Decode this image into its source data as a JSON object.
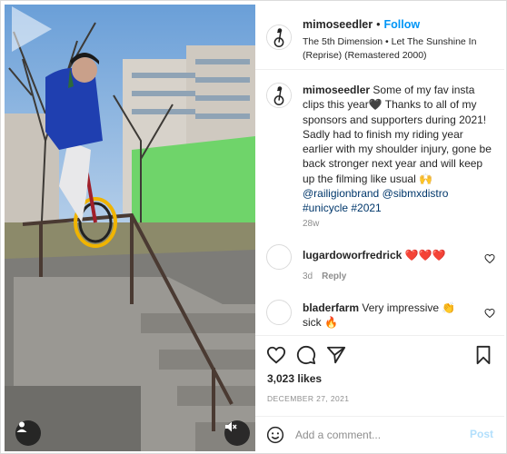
{
  "post": {
    "username": "mimoseedler",
    "follow_label": "Follow",
    "dot": "•",
    "music": "The 5th Dimension • Let The Sunshine In (Reprise) (Remastered 2000)",
    "caption": {
      "text": "Some of my fav insta clips this year🖤 Thanks to all of my sponsors and supporters during 2021! Sadly had to finish my riding year earlier with my shoulder injury, gone be back stronger next year and will keep up the filming like usual 🙌",
      "mentions": "@railigionbrand @sibmxdistro",
      "hashtags": "#unicycle #2021",
      "time_ago": "28w"
    },
    "comments": [
      {
        "username": "lugardoworfredrick",
        "text": "❤️❤️❤️",
        "time_ago": "3d",
        "reply_label": "Reply"
      },
      {
        "username": "bladerfarm",
        "text": "Very impressive 👏 sick 🔥"
      }
    ],
    "likes": "3,023 likes",
    "date": "DECEMBER 27, 2021",
    "comment_placeholder": "Add a comment...",
    "post_label": "Post"
  },
  "icons": {
    "like": "heart-icon",
    "comment": "comment-icon",
    "share": "paper-plane-icon",
    "save": "bookmark-icon",
    "emoji": "smiley-icon",
    "play": "play-icon",
    "user_tag": "user-icon",
    "mute": "speaker-muted-icon"
  },
  "colors": {
    "accent": "#0095f6",
    "text": "#262626",
    "muted": "#8e8e8e",
    "link": "#00376b",
    "border": "#dbdbdb",
    "post_disabled": "#b2dffc",
    "heart": "#ed4956"
  }
}
